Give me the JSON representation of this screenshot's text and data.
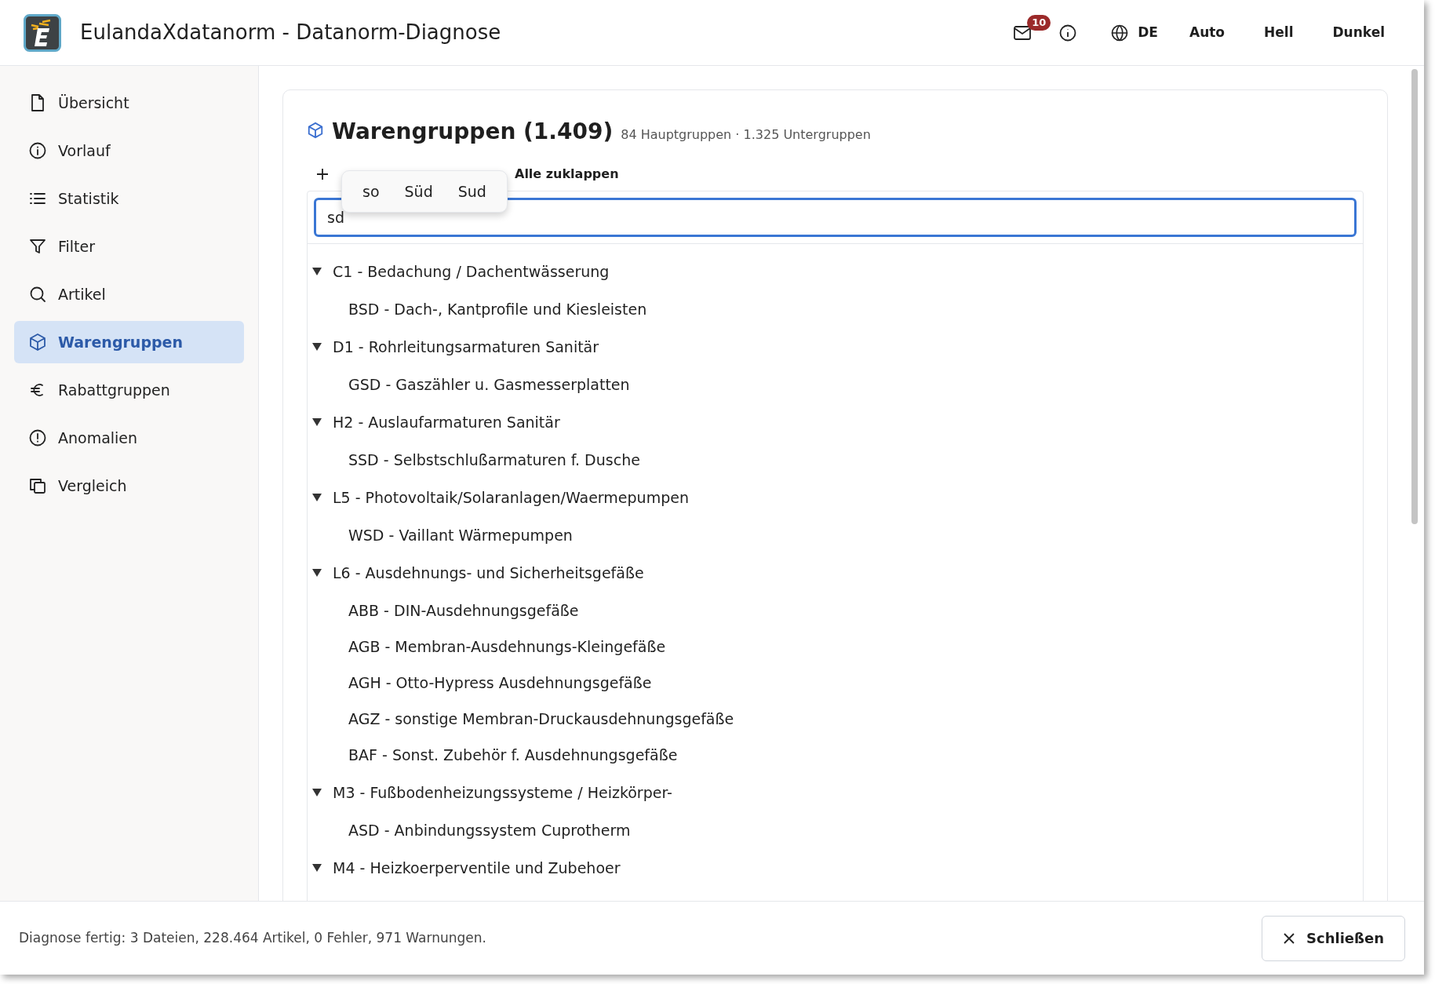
{
  "window": {
    "title": "EulandaXdatanorm - Datanorm-Diagnose"
  },
  "header": {
    "mail_badge": "10",
    "language": "DE",
    "themes": [
      "Auto",
      "Hell",
      "Dunkel"
    ]
  },
  "sidebar": {
    "items": [
      {
        "label": "Übersicht",
        "selected": false
      },
      {
        "label": "Vorlauf",
        "selected": false
      },
      {
        "label": "Statistik",
        "selected": false
      },
      {
        "label": "Filter",
        "selected": false
      },
      {
        "label": "Artikel",
        "selected": false
      },
      {
        "label": "Warengruppen",
        "selected": true
      },
      {
        "label": "Rabattgruppen",
        "selected": false
      },
      {
        "label": "Anomalien",
        "selected": false
      },
      {
        "label": "Vergleich",
        "selected": false
      }
    ]
  },
  "panel": {
    "title": "Warengruppen (1.409)",
    "subtitle": "84 Hauptgruppen · 1.325 Untergruppen",
    "collapse_all": "Alle zuklappen",
    "search": {
      "value": "sd"
    },
    "suggestions": [
      "so",
      "Süd",
      "Sud"
    ],
    "tree": [
      {
        "label": "C1 - Bedachung / Dachentwässerung",
        "expanded": true,
        "children": [
          {
            "label": "BSD - Dach-, Kantprofile und Kiesleisten"
          }
        ]
      },
      {
        "label": "D1 - Rohrleitungsarmaturen Sanitär",
        "expanded": true,
        "children": [
          {
            "label": "GSD - Gaszähler u. Gasmesserplatten"
          }
        ]
      },
      {
        "label": "H2 - Auslaufarmaturen Sanitär",
        "expanded": true,
        "children": [
          {
            "label": "SSD - Selbstschlußarmaturen f. Dusche"
          }
        ]
      },
      {
        "label": "L5 - Photovoltaik/Solaranlagen/Waermepumpen",
        "expanded": true,
        "children": [
          {
            "label": "WSD - Vaillant Wärmepumpen"
          }
        ]
      },
      {
        "label": "L6 - Ausdehnungs- und Sicherheitsgefäße",
        "expanded": true,
        "children": [
          {
            "label": "ABB - DIN-Ausdehnungsgefäße"
          },
          {
            "label": "AGB - Membran-Ausdehnungs-Kleingefäße"
          },
          {
            "label": "AGH - Otto-Hypress Ausdehnungsgefäße"
          },
          {
            "label": "AGZ - sonstige Membran-Druckausdehnungsgefäße"
          },
          {
            "label": "BAF - Sonst. Zubehör f. Ausdehnungsgefäße"
          }
        ]
      },
      {
        "label": "M3 - Fußbodenheizungssysteme / Heizkörper-",
        "expanded": true,
        "children": [
          {
            "label": "ASD - Anbindungssystem Cuprotherm"
          }
        ]
      },
      {
        "label": "M4 - Heizkoerperventile und Zubehoer",
        "expanded": true
      }
    ]
  },
  "status_bar": {
    "message": "Diagnose fertig: 3 Dateien, 228.464 Artikel, 0 Fehler, 971 Warnungen.",
    "close_button": "Schließen"
  }
}
